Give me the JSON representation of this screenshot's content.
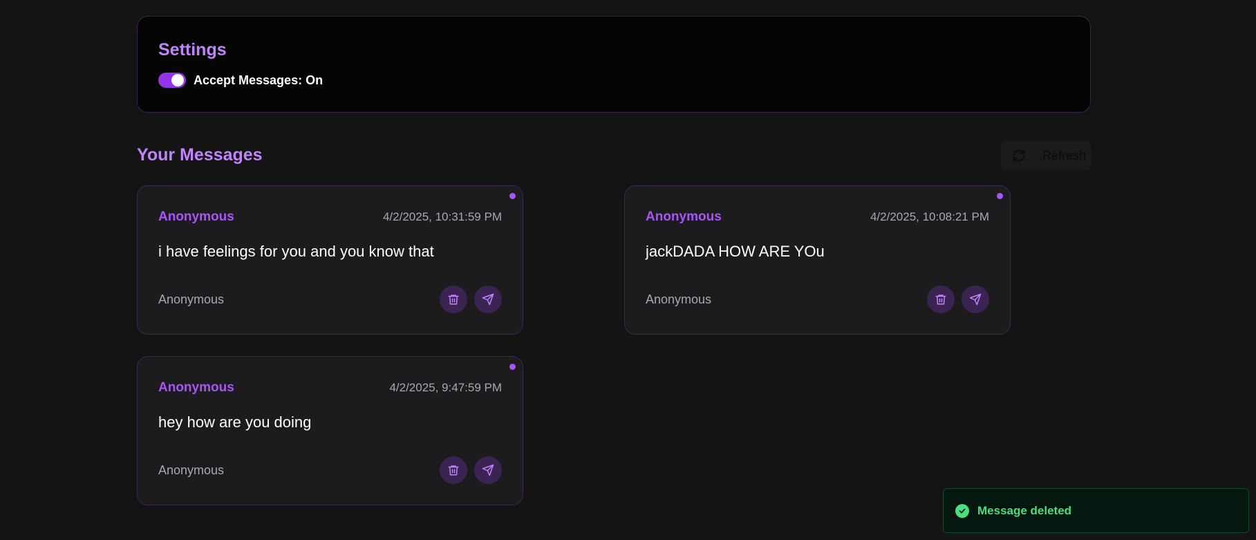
{
  "settings": {
    "title": "Settings",
    "accept_label": "Accept Messages: On"
  },
  "messages_section": {
    "title": "Your Messages",
    "refresh_label": "Refresh"
  },
  "messages": [
    {
      "author": "Anonymous",
      "date": "4/2/2025, 10:31:59 PM",
      "text": "i have feelings for you and you know that",
      "sender": "Anonymous"
    },
    {
      "author": "Anonymous",
      "date": "4/2/2025, 10:08:21 PM",
      "text": "jackDADA HOW ARE YOu",
      "sender": "Anonymous"
    },
    {
      "author": "Anonymous",
      "date": "4/2/2025, 9:47:59 PM",
      "text": "hey how are you doing",
      "sender": "Anonymous"
    }
  ],
  "toast": {
    "text": "Message deleted"
  },
  "colors": {
    "accent": "#a855f7",
    "heading": "#c084fc",
    "success": "#4ade80"
  },
  "icons": {
    "refresh": "refresh-icon",
    "delete": "trash-icon",
    "reply": "send-icon",
    "toast": "check-circle-icon"
  }
}
